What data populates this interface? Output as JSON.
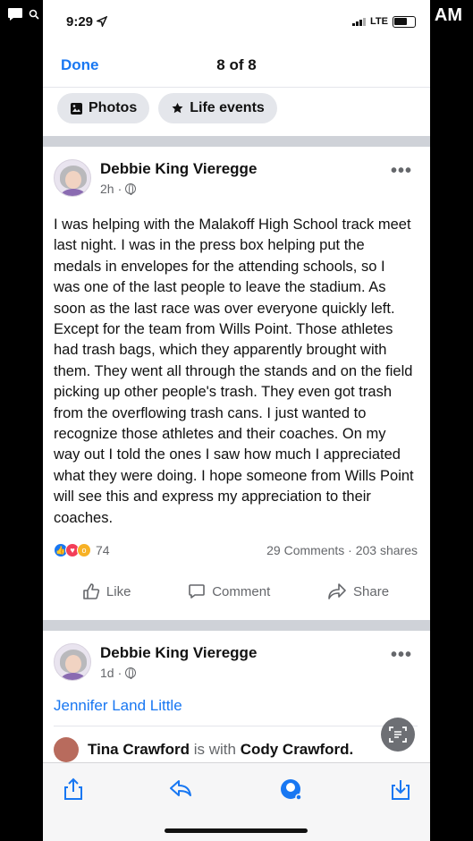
{
  "outer": {
    "clock_suffix": "AM"
  },
  "status": {
    "time": "9:29",
    "network": "LTE"
  },
  "nav": {
    "done": "Done",
    "counter": "8 of 8"
  },
  "chips": [
    {
      "label": "Photos"
    },
    {
      "label": "Life events"
    }
  ],
  "post": {
    "author": "Debbie King Vieregge",
    "time": "2h",
    "text": "I was helping with the Malakoff High School track meet last night. I was in the press box helping put the medals in envelopes for the attending schools, so I was one of the last people to leave the stadium. As soon as the last race was over everyone quickly left. Except for the team from Wills Point. Those athletes had trash bags, which they apparently brought with them. They went all through the stands and on the field picking up other people's trash. They even got trash from the overflowing trash cans.  I just wanted to recognize those athletes and their coaches. On my way out I told the ones I saw how much I appreciated what they were doing. I hope someone from Wills Point will see this and express my appreciation to their coaches.",
    "reactions": "74",
    "comments_shares": "29 Comments · 203 shares",
    "actions": {
      "like": "Like",
      "comment": "Comment",
      "share": "Share"
    }
  },
  "post2": {
    "author": "Debbie King Vieregge",
    "time": "1d",
    "tagged": "Jennifer Land Little",
    "with_name": "Tina Crawford",
    "with_word": "is with",
    "with_other": "Cody Crawford."
  },
  "colors": {
    "accent": "#1877f2",
    "separator": "#cfd2d8"
  }
}
